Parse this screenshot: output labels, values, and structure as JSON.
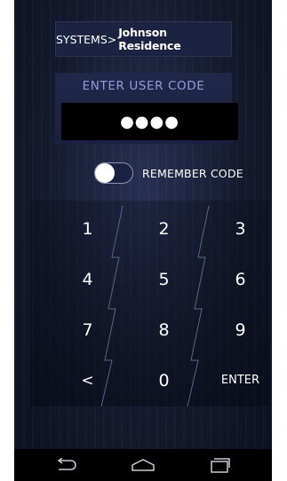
{
  "header": {
    "systems_prefix": "SYSTEMS>",
    "residence_name": "Johnson Residence"
  },
  "code_entry": {
    "label": "ENTER USER CODE",
    "masked_value": "●●●●"
  },
  "remember": {
    "label": "REMEMBER CODE",
    "enabled": false
  },
  "keypad": {
    "keys": [
      "1",
      "2",
      "3",
      "4",
      "5",
      "6",
      "7",
      "8",
      "9",
      "<",
      "0",
      "ENTER"
    ]
  },
  "navbar": {
    "icons": [
      "back-icon",
      "home-icon",
      "recent-apps-icon"
    ]
  },
  "colors": {
    "background": "#151a2e",
    "panel": "#1c2340",
    "label_accent": "#8f9ed8",
    "text": "#ffffff",
    "code_field": "#000000",
    "navbar": "#000000"
  }
}
